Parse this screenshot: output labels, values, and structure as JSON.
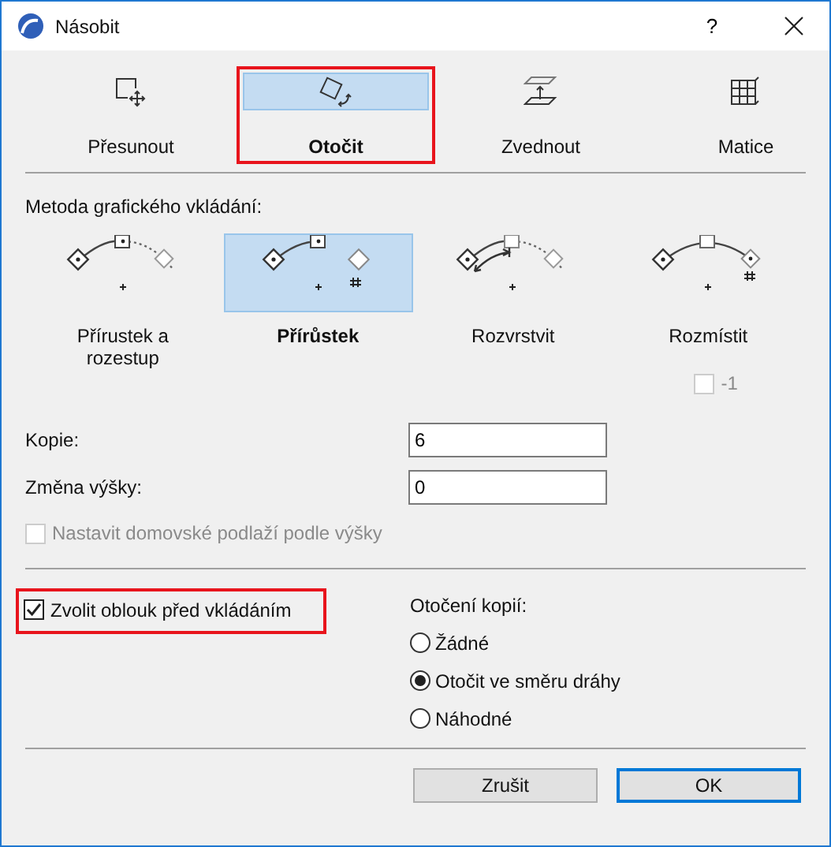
{
  "window": {
    "title": "Násobit",
    "help": "?"
  },
  "tabs": [
    {
      "label": "Přesunout",
      "kind": "move",
      "selected": false,
      "highlighted": false
    },
    {
      "label": "Otočit",
      "kind": "rotate",
      "selected": true,
      "highlighted": true
    },
    {
      "label": "Zvednout",
      "kind": "elevate",
      "selected": false,
      "highlighted": false
    },
    {
      "label": "Matice",
      "kind": "matrix",
      "selected": false,
      "highlighted": false
    }
  ],
  "method_section": {
    "title": "Metoda grafického vkládání:",
    "methods": [
      {
        "label": "Přírustek a rozestup",
        "kind": "increment_spacing",
        "selected": false
      },
      {
        "label": "Přírůstek",
        "kind": "increment",
        "selected": true
      },
      {
        "label": "Rozvrstvit",
        "kind": "layer",
        "selected": false
      },
      {
        "label": "Rozmístit",
        "kind": "spread",
        "selected": false,
        "option": {
          "label": "-1",
          "checked": false,
          "disabled": true
        }
      }
    ]
  },
  "fields": [
    {
      "label": "Kopie:",
      "value": "6"
    },
    {
      "label": "Změna výšky:",
      "value": "0"
    }
  ],
  "home_story": {
    "label": "Nastavit domovské podlaží podle výšky",
    "checked": false,
    "disabled": true
  },
  "arc_option": {
    "label": "Zvolit oblouk před vkládáním",
    "checked": true,
    "disabled": false,
    "highlighted": true
  },
  "rotation": {
    "title": "Otočení kopií:",
    "options": [
      {
        "label": "Žádné",
        "selected": false
      },
      {
        "label": "Otočit ve směru dráhy",
        "selected": true
      },
      {
        "label": "Náhodné",
        "selected": false
      }
    ]
  },
  "buttons": [
    {
      "label": "Zrušit",
      "default": false
    },
    {
      "label": "OK",
      "default": true
    }
  ]
}
